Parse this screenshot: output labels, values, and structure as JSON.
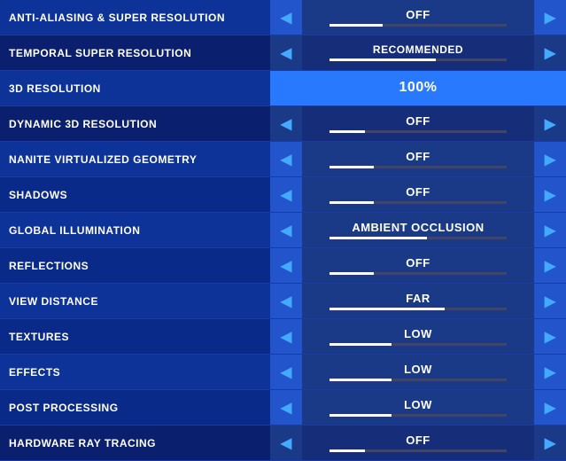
{
  "rows": [
    {
      "id": "anti-aliasing",
      "label": "ANTI-ALIASING & SUPER RESOLUTION",
      "value": "OFF",
      "progressWidth": "30%",
      "rowClass": "",
      "valueClass": "",
      "hasArrows": true,
      "arrowClass": ""
    },
    {
      "id": "temporal-super-resolution",
      "label": "TEMPORAL SUPER RESOLUTION",
      "value": "RECOMMENDED",
      "progressWidth": "60%",
      "rowClass": "tsr-row",
      "valueClass": "recommended-text",
      "hasArrows": true,
      "arrowClass": "dark"
    },
    {
      "id": "3d-resolution",
      "label": "3D RESOLUTION",
      "value": "100%",
      "progressWidth": "100%",
      "rowClass": "resolution-row",
      "valueClass": "",
      "hasArrows": false,
      "arrowClass": ""
    },
    {
      "id": "dynamic-3d-resolution",
      "label": "DYNAMIC 3D RESOLUTION",
      "value": "OFF",
      "progressWidth": "20%",
      "rowClass": "dark-row",
      "valueClass": "",
      "hasArrows": true,
      "arrowClass": "dark"
    },
    {
      "id": "nanite-virtualized-geometry",
      "label": "NANITE VIRTUALIZED GEOMETRY",
      "value": "OFF",
      "progressWidth": "25%",
      "rowClass": "",
      "valueClass": "",
      "hasArrows": true,
      "arrowClass": ""
    },
    {
      "id": "shadows",
      "label": "SHADOWS",
      "value": "OFF",
      "progressWidth": "25%",
      "rowClass": "",
      "valueClass": "",
      "hasArrows": true,
      "arrowClass": ""
    },
    {
      "id": "global-illumination",
      "label": "GLOBAL ILLUMINATION",
      "value": "AMBIENT OCCLUSION",
      "progressWidth": "55%",
      "rowClass": "",
      "valueClass": "",
      "hasArrows": true,
      "arrowClass": ""
    },
    {
      "id": "reflections",
      "label": "REFLECTIONS",
      "value": "OFF",
      "progressWidth": "25%",
      "rowClass": "",
      "valueClass": "",
      "hasArrows": true,
      "arrowClass": ""
    },
    {
      "id": "view-distance",
      "label": "VIEW DISTANCE",
      "value": "FAR",
      "progressWidth": "65%",
      "rowClass": "",
      "valueClass": "",
      "hasArrows": true,
      "arrowClass": ""
    },
    {
      "id": "textures",
      "label": "TEXTURES",
      "value": "LOW",
      "progressWidth": "35%",
      "rowClass": "",
      "valueClass": "",
      "hasArrows": true,
      "arrowClass": ""
    },
    {
      "id": "effects",
      "label": "EFFECTS",
      "value": "LOW",
      "progressWidth": "35%",
      "rowClass": "",
      "valueClass": "",
      "hasArrows": true,
      "arrowClass": ""
    },
    {
      "id": "post-processing",
      "label": "POST PROCESSING",
      "value": "LOW",
      "progressWidth": "35%",
      "rowClass": "",
      "valueClass": "",
      "hasArrows": true,
      "arrowClass": ""
    },
    {
      "id": "hardware-ray-tracing",
      "label": "HARDWARE RAY TRACING",
      "value": "OFF",
      "progressWidth": "20%",
      "rowClass": "tsr-row",
      "valueClass": "",
      "hasArrows": true,
      "arrowClass": "dark"
    }
  ]
}
